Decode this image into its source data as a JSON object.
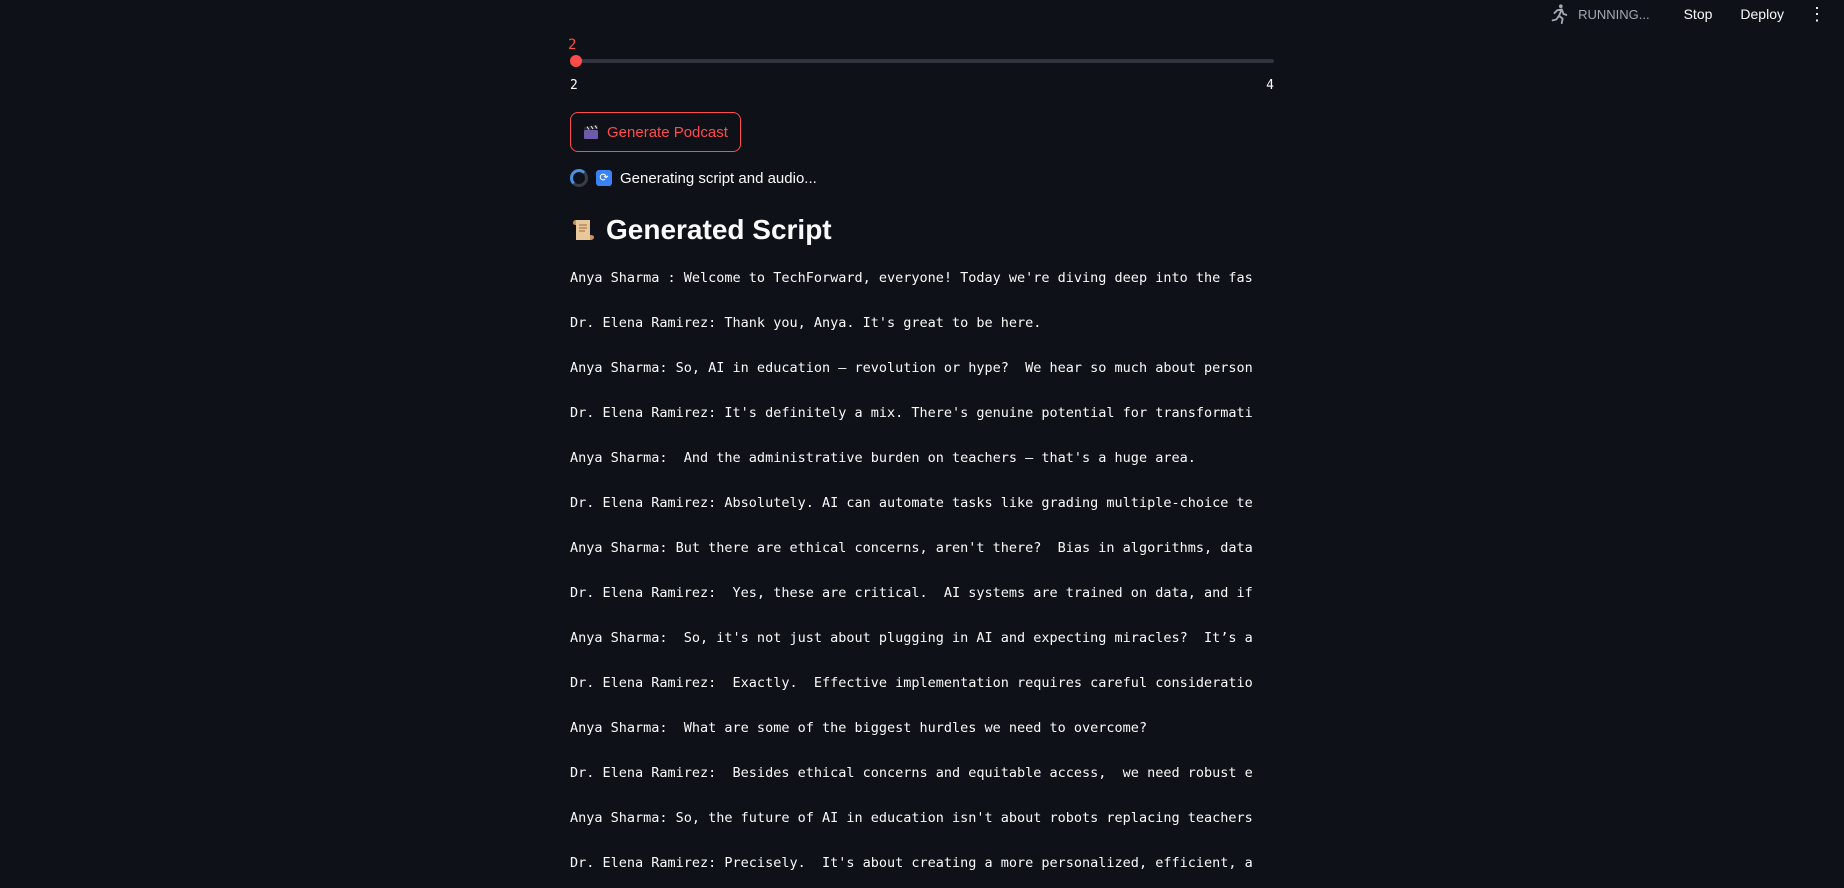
{
  "header": {
    "status_text": "RUNNING...",
    "stop_label": "Stop",
    "deploy_label": "Deploy",
    "menu_glyph": "⋮"
  },
  "slider": {
    "value": "2",
    "min_label": "2",
    "max_label": "4",
    "min": 2,
    "max": 4,
    "current": 2,
    "accent_color": "#ff4b4b"
  },
  "generate_button": {
    "label": "Generate Podcast",
    "icon": "clapper-board-icon"
  },
  "status": {
    "text": "Generating script and audio...",
    "icons": [
      "spinner-icon",
      "refresh-icon"
    ]
  },
  "script_section": {
    "title": "Generated Script",
    "icon": "scroll-icon"
  },
  "script": {
    "lines": [
      "Anya Sharma : Welcome to TechForward, everyone! Today we're diving deep into the fas",
      "Dr. Elena Ramirez: Thank you, Anya. It's great to be here.",
      "Anya Sharma: So, AI in education – revolution or hype?  We hear so much about person",
      "Dr. Elena Ramirez: It's definitely a mix. There's genuine potential for transformati",
      "Anya Sharma:  And the administrative burden on teachers – that's a huge area.",
      "Dr. Elena Ramirez: Absolutely. AI can automate tasks like grading multiple-choice te",
      "Anya Sharma: But there are ethical concerns, aren't there?  Bias in algorithms, data",
      "Dr. Elena Ramirez:  Yes, these are critical.  AI systems are trained on data, and if",
      "Anya Sharma:  So, it's not just about plugging in AI and expecting miracles?  It’s a",
      "Dr. Elena Ramirez:  Exactly.  Effective implementation requires careful consideratio",
      "Anya Sharma:  What are some of the biggest hurdles we need to overcome?",
      "Dr. Elena Ramirez:  Besides ethical concerns and equitable access,  we need robust e",
      "Anya Sharma: So, the future of AI in education isn't about robots replacing teachers",
      "Dr. Elena Ramirez: Precisely.  It's about creating a more personalized, efficient, a"
    ]
  }
}
